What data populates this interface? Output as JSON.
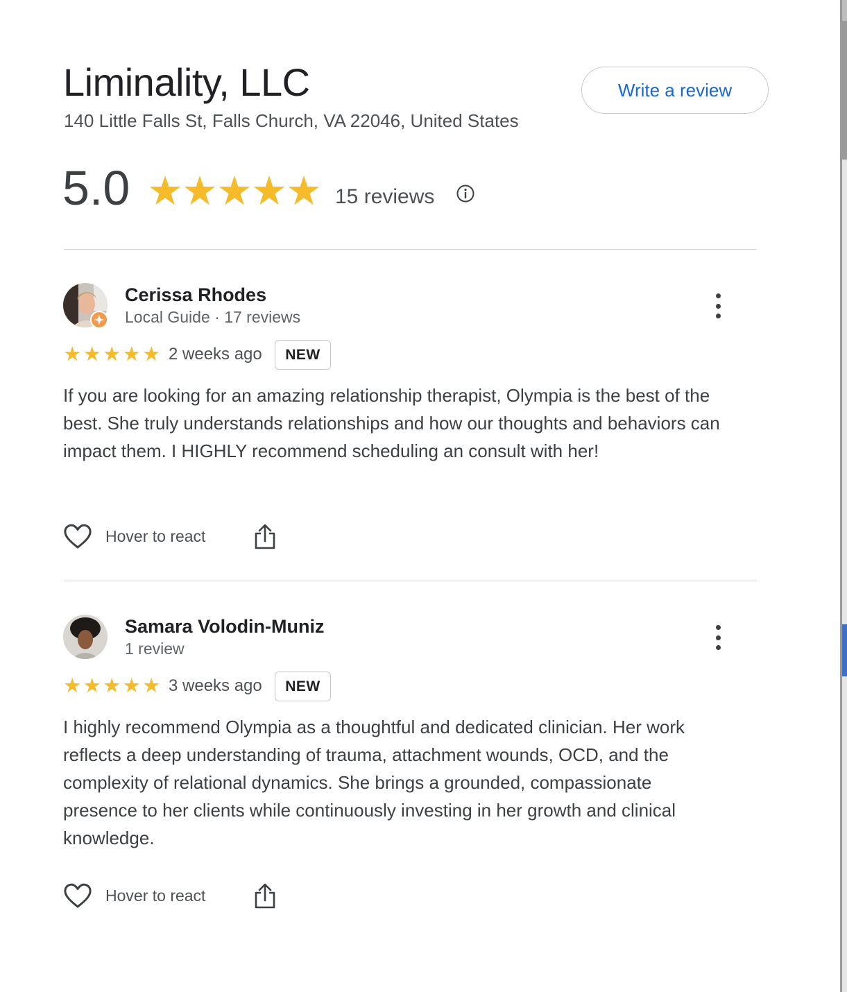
{
  "business": {
    "name": "Liminality, LLC",
    "address": "140 Little Falls St, Falls Church, VA 22046, United States",
    "write_review_label": "Write a review"
  },
  "rating": {
    "average": "5.0",
    "stars": 5,
    "count_label": "15 reviews",
    "star_color": "#f5bb2a",
    "info_icon": "info-icon"
  },
  "reviews": [
    {
      "name": "Cerissa Rhodes",
      "meta": "Local Guide · 17 reviews",
      "stars": 5,
      "time": "2 weeks ago",
      "badge": "NEW",
      "text": "If you are looking for an amazing relationship therapist, Olympia is the best of the best. She truly understands relationships and how our thoughts and behaviors can impact them. I HIGHLY recommend scheduling an consult with her!",
      "react_label": "Hover to react"
    },
    {
      "name": "Samara Volodin-Muniz",
      "meta": "1 review",
      "stars": 5,
      "time": "3 weeks ago",
      "badge": "NEW",
      "text": "I highly recommend Olympia as a thoughtful and dedicated clinician. Her work reflects a deep understanding of trauma, attachment wounds, OCD, and the complexity of relational dynamics. She brings a grounded, compassionate presence to her clients while continuously investing in her growth and clinical knowledge.",
      "react_label": "Hover to react"
    }
  ],
  "colors": {
    "link_blue": "#1a67d2",
    "local_guide_badge": "#f29b4b"
  }
}
